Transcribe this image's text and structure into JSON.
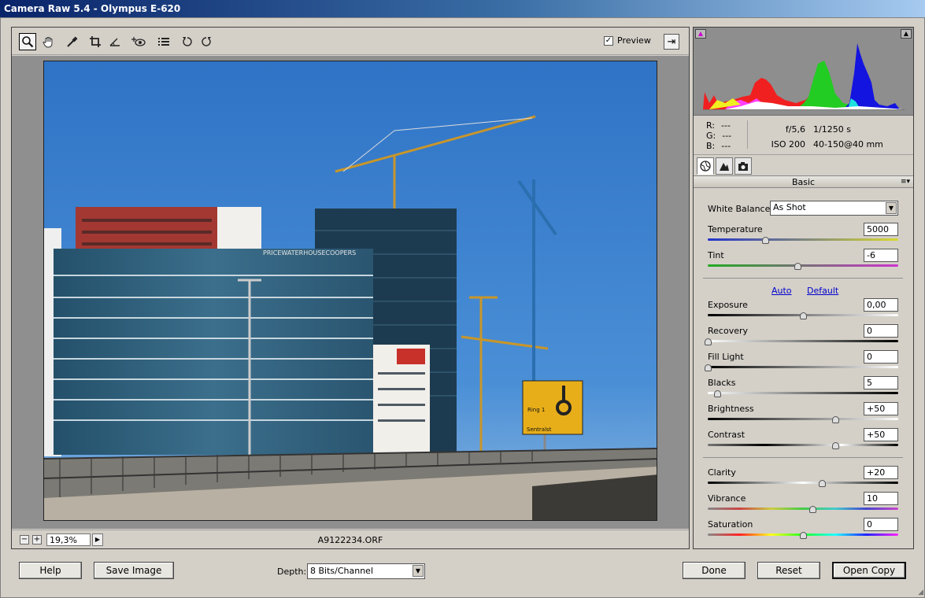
{
  "window": {
    "title": "Camera Raw 5.4  -  Olympus E-620"
  },
  "toolbar": {
    "tools": [
      "zoom-icon",
      "hand-icon",
      "white-balance-icon",
      "crop-icon",
      "straighten-icon",
      "red-eye-icon",
      "list-icon",
      "rotate-left-icon",
      "rotate-right-icon"
    ],
    "preview_label": "Preview",
    "preview_checked": true
  },
  "status": {
    "zoom_value": "19,3%",
    "filename": "A9122234.ORF"
  },
  "info": {
    "r_label": "R:",
    "r_value": "---",
    "g_label": "G:",
    "g_value": "---",
    "b_label": "B:",
    "b_value": "---",
    "aperture": "f/5,6",
    "shutter": "1/1250 s",
    "iso": "ISO 200",
    "lens": "40-150@40 mm"
  },
  "panel": {
    "title": "Basic"
  },
  "basic": {
    "white_balance_label": "White Balance:",
    "white_balance_value": "As Shot",
    "temperature_label": "Temperature",
    "temperature_value": "5000",
    "tint_label": "Tint",
    "tint_value": "-6",
    "auto_label": "Auto",
    "default_label": "Default",
    "exposure_label": "Exposure",
    "exposure_value": "0,00",
    "recovery_label": "Recovery",
    "recovery_value": "0",
    "fill_light_label": "Fill Light",
    "fill_light_value": "0",
    "blacks_label": "Blacks",
    "blacks_value": "5",
    "brightness_label": "Brightness",
    "brightness_value": "+50",
    "contrast_label": "Contrast",
    "contrast_value": "+50",
    "clarity_label": "Clarity",
    "clarity_value": "+20",
    "vibrance_label": "Vibrance",
    "vibrance_value": "10",
    "saturation_label": "Saturation",
    "saturation_value": "0"
  },
  "slider_levels": {
    "temperature": 0.3,
    "tint": 0.47,
    "exposure": 0.5,
    "recovery": 0.0,
    "fill_light": 0.0,
    "blacks": 0.05,
    "brightness": 0.67,
    "contrast": 0.67,
    "clarity": 0.6,
    "vibrance": 0.55,
    "saturation": 0.5
  },
  "footer": {
    "help_label": "Help",
    "save_label": "Save Image",
    "depth_label": "Depth:",
    "depth_value": "8 Bits/Channel",
    "done_label": "Done",
    "reset_label": "Reset",
    "open_label": "Open Copy"
  },
  "photo": {
    "sign_text_1": "Ring 1",
    "sign_text_2": "Sentralst",
    "building_text": "PRICEWATERHOUSECOOPERS"
  },
  "colors": {
    "sky": "#3b7fd0",
    "titlebar": "#0a246a",
    "link": "#0000cc"
  }
}
